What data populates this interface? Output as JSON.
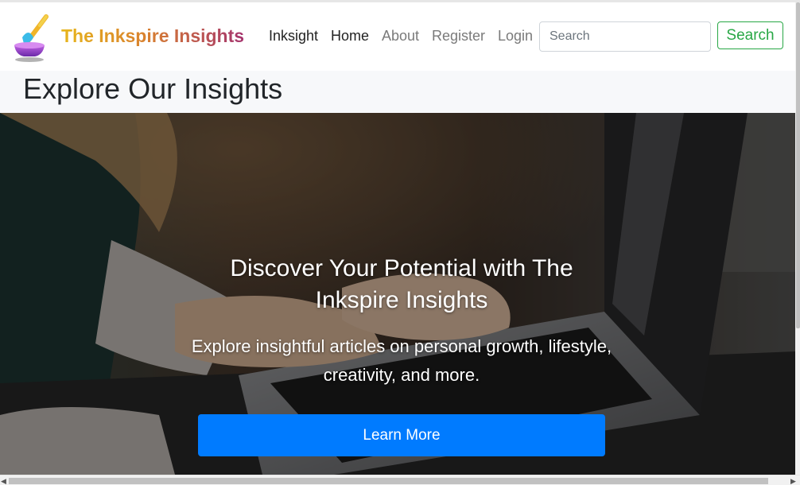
{
  "navbar": {
    "brand": "The Inkspire Insights",
    "logo_icon": "paint-brush-bowl-icon",
    "links": [
      "Inksight",
      "Home",
      "About",
      "Register",
      "Login"
    ],
    "search_placeholder": "Search",
    "search_value": "",
    "search_button": "Search"
  },
  "header": {
    "title": "Explore Our Insights"
  },
  "hero": {
    "heading": "Discover Your Potential with The Inkspire Insights",
    "text": "Explore insightful articles on personal growth, lifestyle, creativity, and more.",
    "button": "Learn More",
    "background": "photo of hands typing on laptop keyboard"
  },
  "colors": {
    "primary": "#007bff",
    "success": "#28a745",
    "brand_gold": "#e7b61c",
    "brand_magenta": "#a5346e"
  }
}
